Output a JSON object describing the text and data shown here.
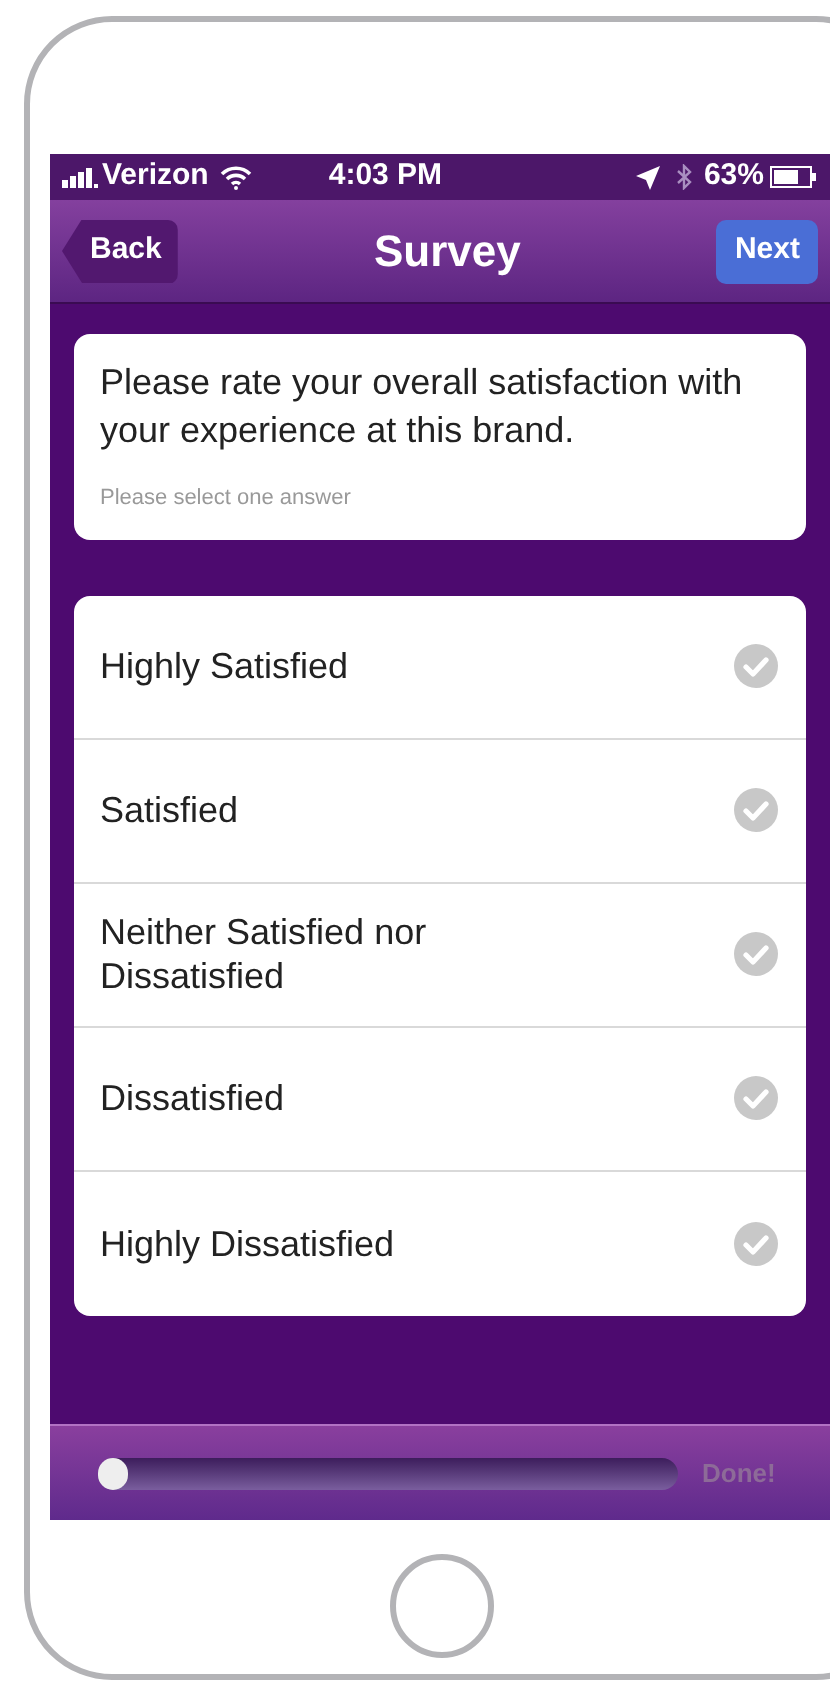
{
  "status_bar": {
    "carrier": "Verizon",
    "time": "4:03 PM",
    "battery": "63%"
  },
  "nav_bar": {
    "back": "Back",
    "title": "Survey",
    "next": "Next"
  },
  "question": {
    "text": "Please rate your overall satisfaction with your experience at this brand.",
    "hint": "Please select one answer"
  },
  "answers": [
    {
      "label": "Highly Satisfied",
      "selected": false
    },
    {
      "label": "Satisfied",
      "selected": false
    },
    {
      "label": "Neither Satisfied nor Dissatisfied",
      "selected": false
    },
    {
      "label": "Dissatisfied",
      "selected": false
    },
    {
      "label": "Highly Dissatisfied",
      "selected": false
    }
  ],
  "progress": {
    "level": 0.05,
    "label": "Done!"
  }
}
